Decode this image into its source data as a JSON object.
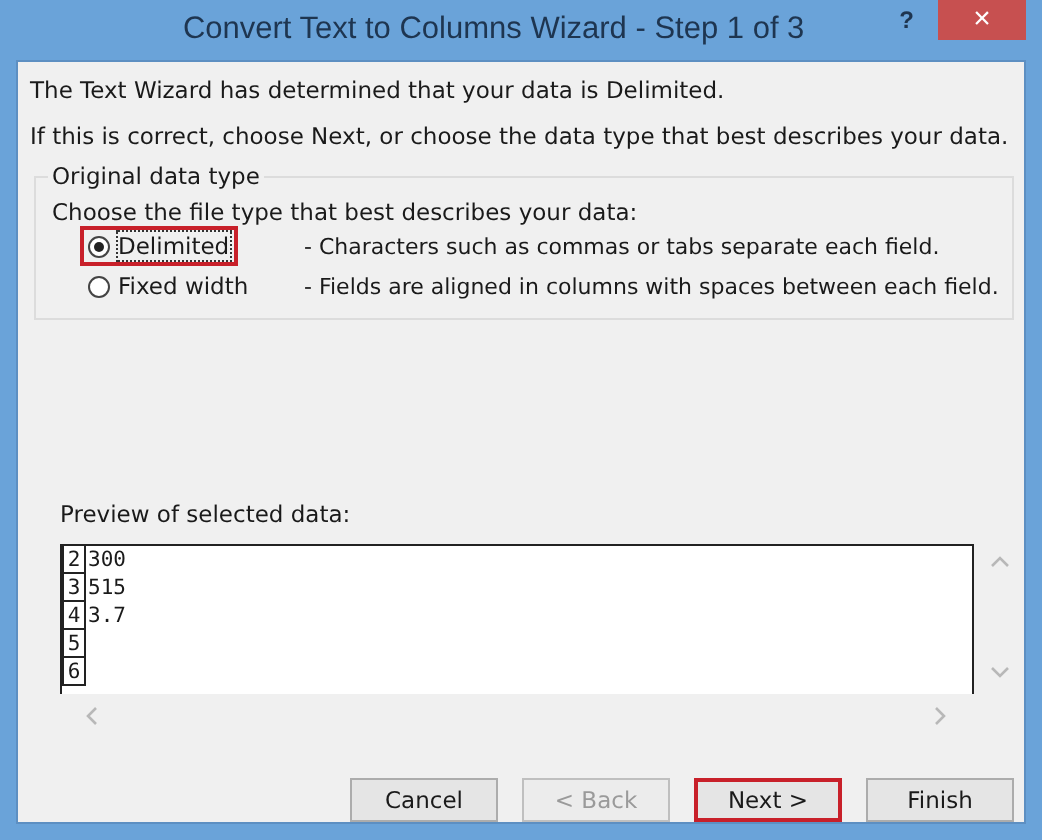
{
  "window": {
    "title": "Convert Text to Columns Wizard - Step 1 of 3",
    "help": "?",
    "close": "×"
  },
  "intro": [
    "The Text Wizard has determined that your data is Delimited.",
    "If this is correct, choose Next, or choose the data type that best describes your data."
  ],
  "group": {
    "title": "Original data type",
    "prompt": "Choose the file type that best describes your data:",
    "options": [
      {
        "label": "Delimited",
        "description": "- Characters such as commas or tabs separate each field.",
        "selected": true,
        "highlighted": true
      },
      {
        "label": "Fixed width",
        "description": "- Fields are aligned in columns with spaces between each field.",
        "selected": false,
        "highlighted": false
      }
    ]
  },
  "preview": {
    "label": "Preview of selected data:",
    "rows": [
      {
        "number": "2",
        "value": "300"
      },
      {
        "number": "3",
        "value": "515"
      },
      {
        "number": "4",
        "value": "3.7"
      },
      {
        "number": "5"
      },
      {
        "number": "6"
      }
    ]
  },
  "buttons": [
    {
      "label": "Cancel",
      "disabled": false,
      "highlighted": false
    },
    {
      "label": "< Back",
      "disabled": true,
      "highlighted": false
    },
    {
      "label": "Next >",
      "disabled": false,
      "highlighted": true
    },
    {
      "label": "Finish",
      "disabled": false,
      "highlighted": false
    }
  ]
}
